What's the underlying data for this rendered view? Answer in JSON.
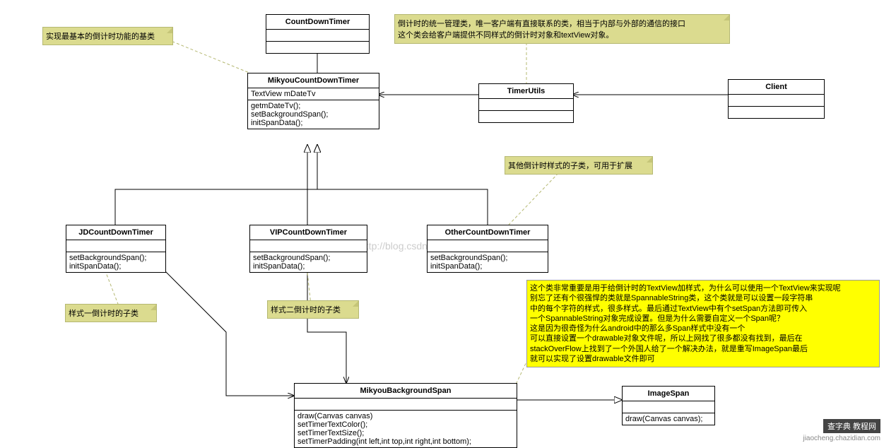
{
  "classes": {
    "countDownTimer": {
      "name": "CountDownTimer"
    },
    "mikyouCountDownTimer": {
      "name": "MikyouCountDownTimer",
      "attrs": "TextView mDateTv",
      "ops": "getmDateTv();\nsetBackgroundSpan();\ninitSpanData();"
    },
    "timerUtils": {
      "name": "TimerUtils"
    },
    "client": {
      "name": "Client"
    },
    "jd": {
      "name": "JDCountDownTimer",
      "ops": "setBackgroundSpan();\ninitSpanData();"
    },
    "vip": {
      "name": "VIPCountDownTimer",
      "ops": "setBackgroundSpan();\ninitSpanData();"
    },
    "other": {
      "name": "OtherCountDownTimer",
      "ops": "setBackgroundSpan();\ninitSpanData();"
    },
    "mikyouBg": {
      "name": "MikyouBackgroundSpan",
      "ops": "draw(Canvas canvas)\nsetTimerTextColor();\nsetTimerTextSize();\nsetTimerPadding(int left,int top,int right,int bottom);"
    },
    "imageSpan": {
      "name": "ImageSpan",
      "ops": "draw(Canvas canvas);"
    }
  },
  "notes": {
    "n1": "实现最基本的倒计时功能的基类",
    "n2": "倒计时的统一管理类，唯一客户端有直接联系的类，相当于内部与外部的通信的接口\n这个类会给客户端提供不同样式的倒计时对象和textView对象。",
    "n3": "其他倒计时样式的子类，可用于扩展",
    "n4": "样式一倒计时的子类",
    "n5": "样式二倒计时的子类",
    "n6": "这个类非常重要是用于给倒计时的TextView加样式，为什么可以使用一个TextView来实现呢\n别忘了还有个很强悍的类就是SpannableString类，这个类就是可以设置一段字符串\n中的每个字符的样式，很多样式。最后通过TextView中有个setSpan方法即可传入\n一个SpannableString对象完成设置。但是为什么需要自定义一个Span呢？\n这是因为很奇怪为什么android中的那么多Span样式中没有一个\n可以直接设置一个drawable对象文件呢，所以上网找了很多都没有找到，最后在\nstackOverFlow上找到了一个外国人给了一个解决办法，就是重写ImageSpan最后\n就可以实现了设置drawable文件即可"
  },
  "watermark": "jiaocheng.chazidian.com",
  "wm2": "http://blog.csdn.net/",
  "badge": "查字典 教程网"
}
